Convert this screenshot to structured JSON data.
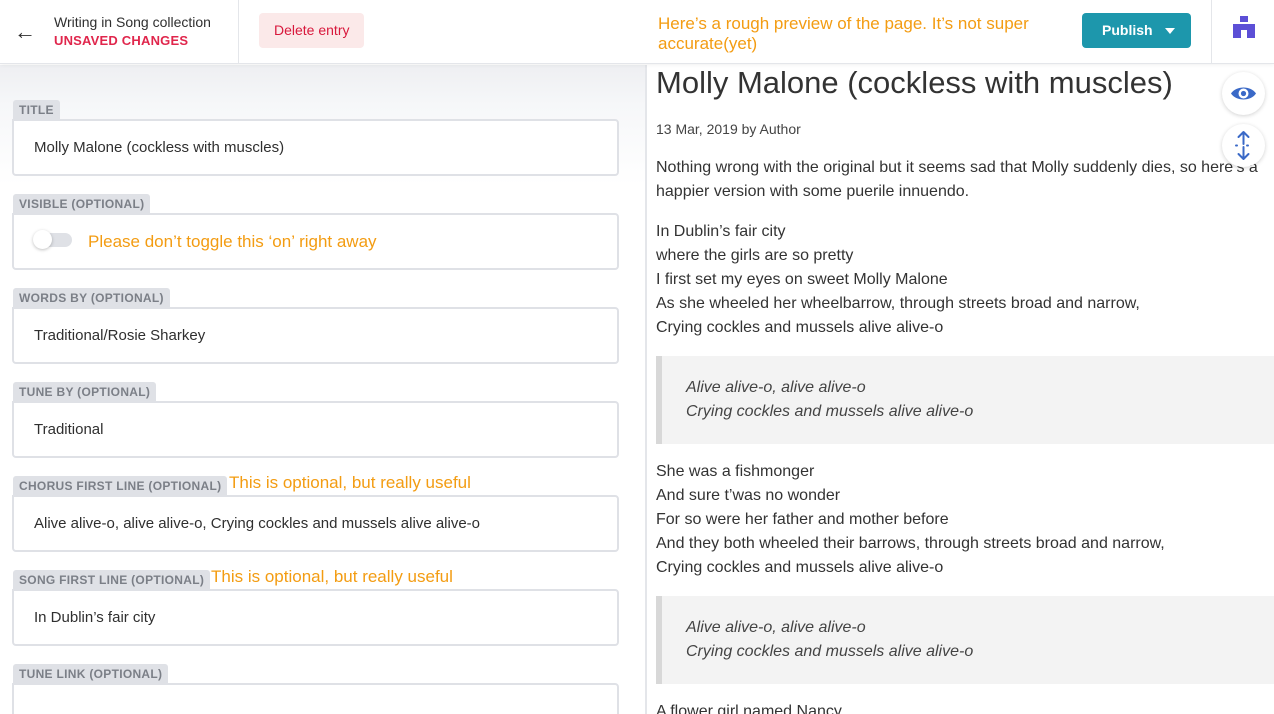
{
  "header": {
    "back_icon": "arrow-left-icon",
    "crumb": "Writing in Song collection",
    "status": "UNSAVED CHANGES",
    "delete_label": "Delete entry",
    "note": "Here’s a rough preview of the page. It’s not super accurate(yet)",
    "publish_label": "Publish",
    "cms_icon": "netlify-cms-icon"
  },
  "form": {
    "fields": [
      {
        "label": "TITLE",
        "value": "Molly Malone (cockless with muscles)"
      },
      {
        "label": "VISIBLE (OPTIONAL)",
        "hint": "Please don’t toggle this ‘on’ right away"
      },
      {
        "label": "WORDS BY (OPTIONAL)",
        "value": "Traditional/Rosie Sharkey"
      },
      {
        "label": "TUNE BY (OPTIONAL)",
        "value": "Traditional"
      },
      {
        "label": "CHORUS FIRST LINE (OPTIONAL)",
        "value": "Alive alive-o, alive alive-o, Crying cockles and mussels alive alive-o",
        "hint": "This is optional, but really useful"
      },
      {
        "label": "SONG FIRST LINE (OPTIONAL)",
        "value": "In Dublin’s fair city",
        "hint": "This is optional, but really useful"
      },
      {
        "label": "TUNE LINK (OPTIONAL)",
        "value": ""
      }
    ]
  },
  "preview": {
    "title": "Molly Malone (cockless with muscles)",
    "meta": "13 Mar, 2019 by Author",
    "intro": [
      "Nothing wrong with the original but it seems sad that Molly suddenly dies, so here’s a",
      "happier version with some puerile innuendo."
    ],
    "verse1": [
      "In Dublin’s fair city",
      "where the girls are so pretty",
      "I first set my eyes on sweet Molly Malone",
      "As she wheeled her wheelbarrow, through streets broad and narrow,",
      "Crying cockles and mussels alive alive-o"
    ],
    "chorus": [
      "Alive alive-o, alive alive-o",
      "Crying cockles and mussels alive alive-o"
    ],
    "verse2": [
      "She was a fishmonger",
      "And sure t’was no wonder",
      "For so were her father and mother before",
      "And they both wheeled their barrows, through streets broad and narrow,",
      "Crying cockles and mussels alive alive-o"
    ],
    "verse3_start": "A flower girl named Nancy",
    "eye_icon": "eye-icon",
    "sync_icon": "sync-scroll-icon"
  },
  "colors": {
    "accent": "#1d97ac",
    "danger": "#e0264c",
    "note": "#f39c12"
  }
}
